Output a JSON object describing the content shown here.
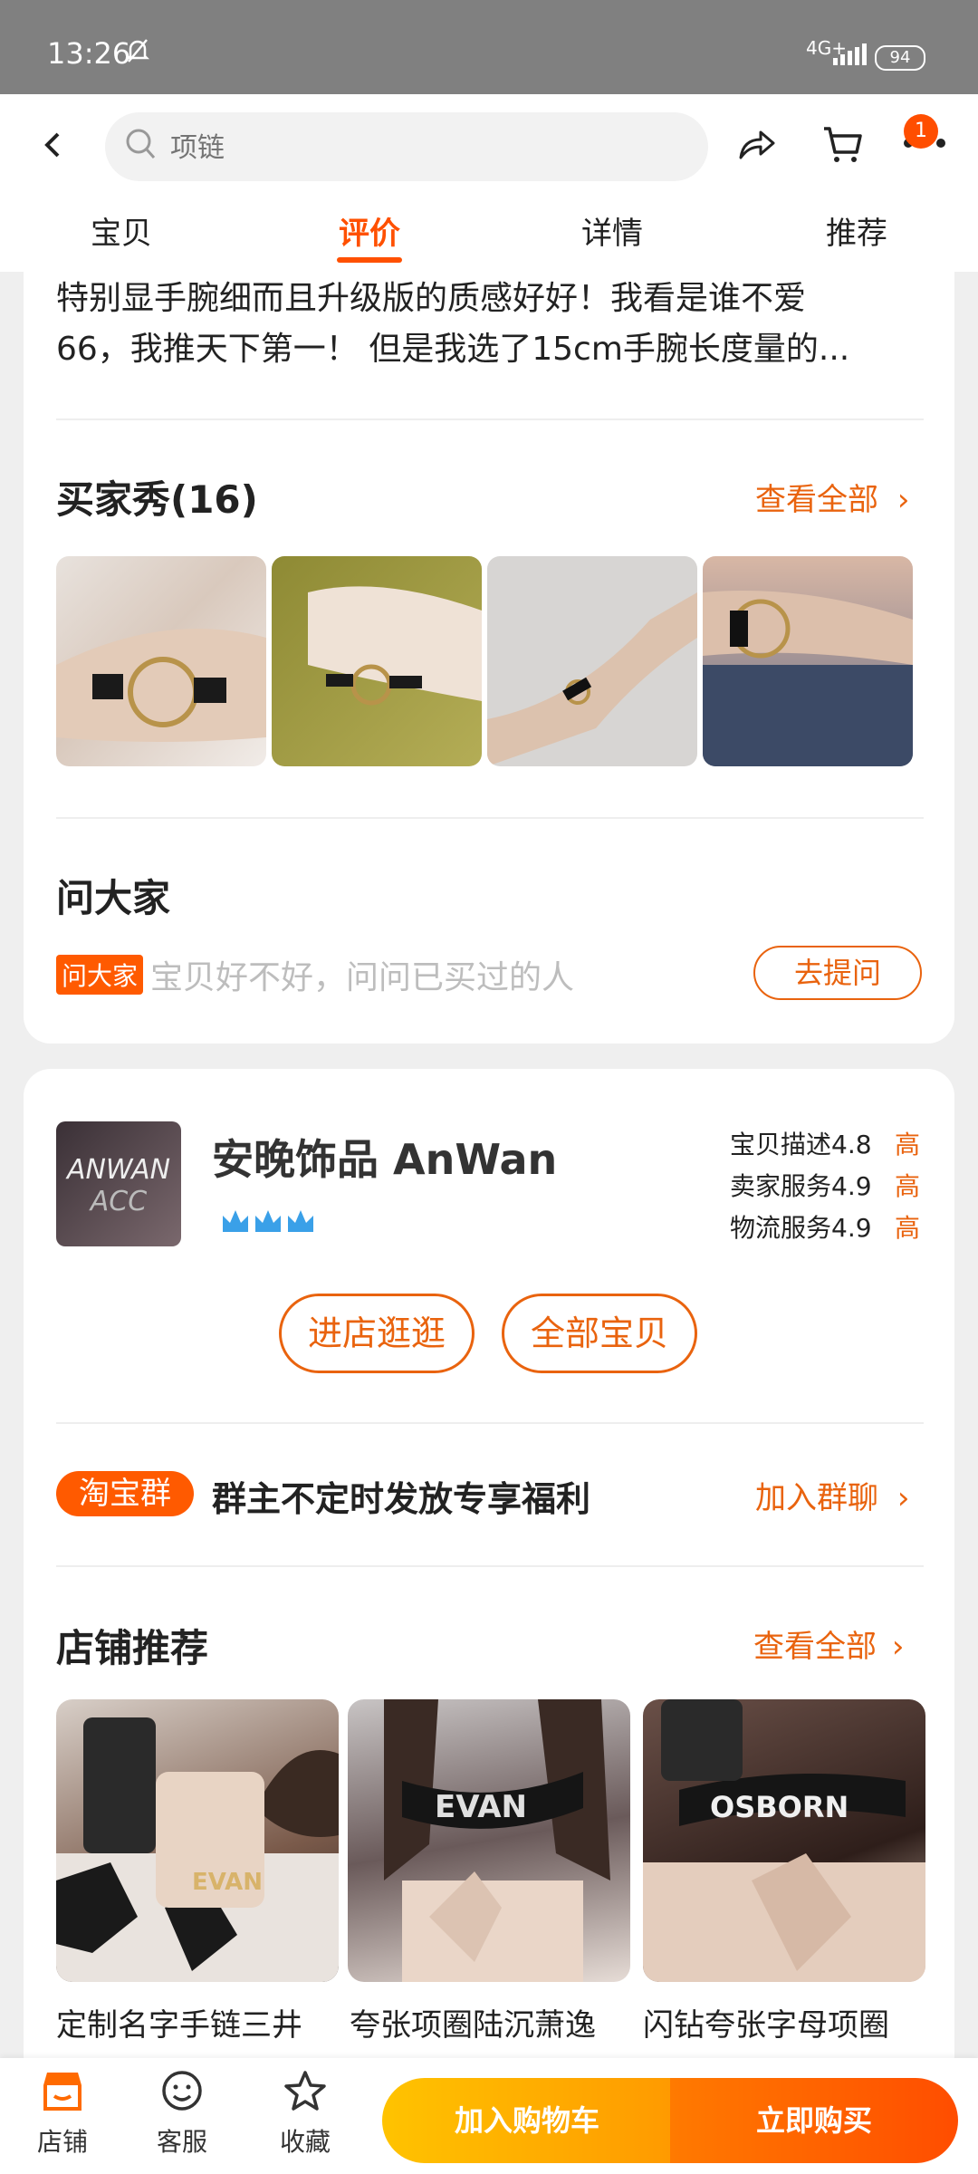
{
  "status_bar": {
    "time": "13:26",
    "network": "4G+",
    "battery": "94"
  },
  "header": {
    "search_placeholder": "项链",
    "cart_badge": "1",
    "tabs": [
      "宝贝",
      "评价",
      "详情",
      "推荐"
    ]
  },
  "review": {
    "text_line1": "特别显手腕细而且升级版的质感好好！我看是谁不爱",
    "text_line2": "66，我推天下第一！ 但是我选了15cm手腕长度量的..."
  },
  "buyer_show": {
    "title": "买家秀(16)",
    "view_all": "查看全部"
  },
  "ask": {
    "title": "问大家",
    "tag": "问大家",
    "prompt": "宝贝好不好，问问已买过的人",
    "button": "去提问"
  },
  "shop": {
    "logo_line1": "ANWAN",
    "logo_line2": "ACC",
    "name": "安晚饰品 AnWan",
    "ratings": [
      {
        "label": "宝贝描述4.8",
        "level": "高"
      },
      {
        "label": "卖家服务4.9",
        "level": "高"
      },
      {
        "label": "物流服务4.9",
        "level": "高"
      }
    ],
    "enter_shop": "进店逛逛",
    "all_items": "全部宝贝"
  },
  "group": {
    "tag": "淘宝群",
    "text": "群主不定时发放专享福利",
    "join": "加入群聊"
  },
  "shop_recommend": {
    "title": "店铺推荐",
    "view_all": "查看全部",
    "products": [
      {
        "title": "定制名字手链三井",
        "image_text": "EVAN"
      },
      {
        "title": "夸张项圈陆沉萧逸",
        "image_text": "EVAN"
      },
      {
        "title": "闪钻夸张字母项圈",
        "image_text": "OSBORN"
      }
    ]
  },
  "bottom_bar": {
    "shop": "店铺",
    "service": "客服",
    "favorite": "收藏",
    "add_cart": "加入购物车",
    "buy_now": "立即购买"
  },
  "colors": {
    "accent": "#e9630e",
    "brand_orange": "#ff5000"
  }
}
